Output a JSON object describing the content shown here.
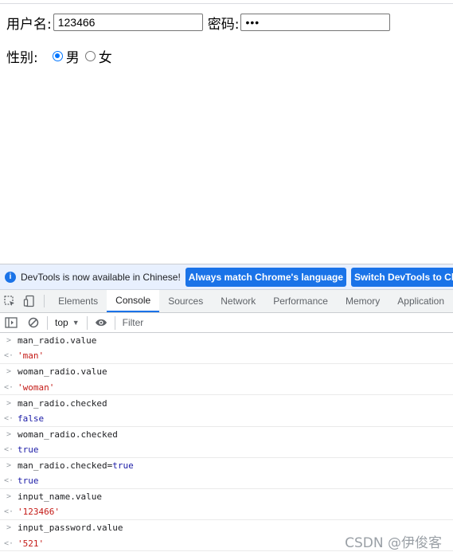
{
  "form": {
    "username_label": "用户名:",
    "username_value": "123466",
    "password_label": "密码:",
    "password_value": "•••",
    "gender_label": "性别:",
    "radio_man_label": "男",
    "radio_woman_label": "女",
    "selected_gender": "man"
  },
  "devtools": {
    "infobar": {
      "text": "DevTools is now available in Chinese!",
      "button_match": "Always match Chrome's language",
      "button_switch": "Switch DevTools to Chinese"
    },
    "tabs": [
      "Elements",
      "Console",
      "Sources",
      "Network",
      "Performance",
      "Memory",
      "Application"
    ],
    "active_tab": "Console",
    "context": "top",
    "filter_placeholder": "Filter",
    "console": [
      {
        "input": "man_radio.value",
        "output": "'man'",
        "output_type": "string"
      },
      {
        "input": "woman_radio.value",
        "output": "'woman'",
        "output_type": "string"
      },
      {
        "input": "man_radio.checked",
        "output": "false",
        "output_type": "keyword"
      },
      {
        "input": "woman_radio.checked",
        "output": "true",
        "output_type": "keyword"
      },
      {
        "input_parts": [
          "man_radio.checked= ",
          "true"
        ],
        "output": "true",
        "output_type": "keyword"
      },
      {
        "input": "input_name.value",
        "output": "'123466'",
        "output_type": "string"
      },
      {
        "input": "input_password.value",
        "output": "'521'",
        "output_type": "string"
      }
    ]
  },
  "watermark": "CSDN @伊俊客",
  "colors": {
    "accent": "#1a73e8",
    "string": "#c41a16",
    "keyword": "#1a1aa6"
  }
}
